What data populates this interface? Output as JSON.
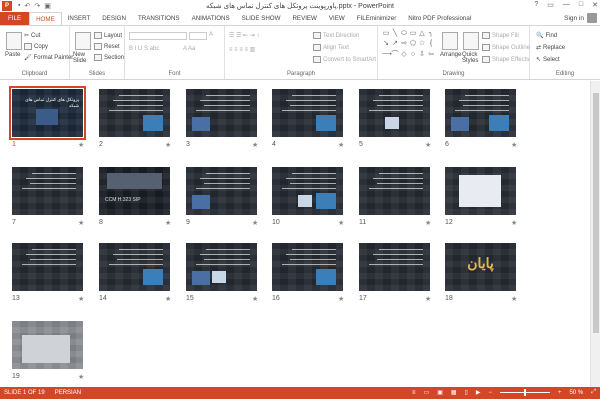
{
  "titlebar": {
    "app_icon": "P",
    "title": "پاورپوینت پروتکل های کنترل تماس های شبکه.pptx - PowerPoint",
    "qat": [
      "save-icon",
      "undo-icon",
      "redo-icon",
      "slideshow-icon"
    ],
    "controls": [
      "?",
      "▭",
      "—",
      "□",
      "✕"
    ]
  },
  "tabs": [
    "FILE",
    "HOME",
    "INSERT",
    "DESIGN",
    "TRANSITIONS",
    "ANIMATIONS",
    "SLIDE SHOW",
    "REVIEW",
    "VIEW",
    "FILEminimizer",
    "Nitro PDF Professional"
  ],
  "signin": "Sign in",
  "ribbon": {
    "clipboard": {
      "paste": "Paste",
      "cut": "Cut",
      "copy": "Copy",
      "format_painter": "Format Painter",
      "label": "Clipboard"
    },
    "slides": {
      "new_slide": "New Slide",
      "layout": "Layout",
      "reset": "Reset",
      "section": "Section",
      "label": "Slides"
    },
    "font": {
      "label": "Font"
    },
    "paragraph": {
      "text_direction": "Text Direction",
      "align_text": "Align Text",
      "convert_smartart": "Convert to SmartArt",
      "label": "Paragraph"
    },
    "drawing": {
      "arrange": "Arrange",
      "quick_styles": "Quick Styles",
      "shape_fill": "Shape Fill",
      "shape_outline": "Shape Outline",
      "shape_effects": "Shape Effects",
      "label": "Drawing",
      "shapes": [
        "▭",
        "╲",
        "⬭",
        "▭",
        "△",
        "╮",
        "↘",
        "↗",
        "⇨",
        "⬠",
        "☆",
        "{",
        "⟶",
        "⌒",
        "◇",
        "○",
        "⇩",
        "⇦"
      ]
    },
    "editing": {
      "find": "Find",
      "replace": "Replace",
      "select": "Select",
      "label": "Editing"
    }
  },
  "slides": [
    {
      "num": "1",
      "selected": true
    },
    {
      "num": "2"
    },
    {
      "num": "3"
    },
    {
      "num": "4"
    },
    {
      "num": "5"
    },
    {
      "num": "6"
    },
    {
      "num": "7"
    },
    {
      "num": "8"
    },
    {
      "num": "9"
    },
    {
      "num": "10"
    },
    {
      "num": "11"
    },
    {
      "num": "12"
    },
    {
      "num": "13"
    },
    {
      "num": "14"
    },
    {
      "num": "15"
    },
    {
      "num": "16"
    },
    {
      "num": "17"
    },
    {
      "num": "18"
    },
    {
      "num": "19"
    }
  ],
  "slide_labels": {
    "title1": "پروتکل های کنترل تماس های شبکه",
    "s8_text": "CCM  H.323  SIP",
    "s18_text": "پایان"
  },
  "status": {
    "slide": "SLIDE 1 OF 19",
    "language": "PERSIAN",
    "zoom": "50 %"
  },
  "colors": {
    "accent": "#d24726"
  }
}
